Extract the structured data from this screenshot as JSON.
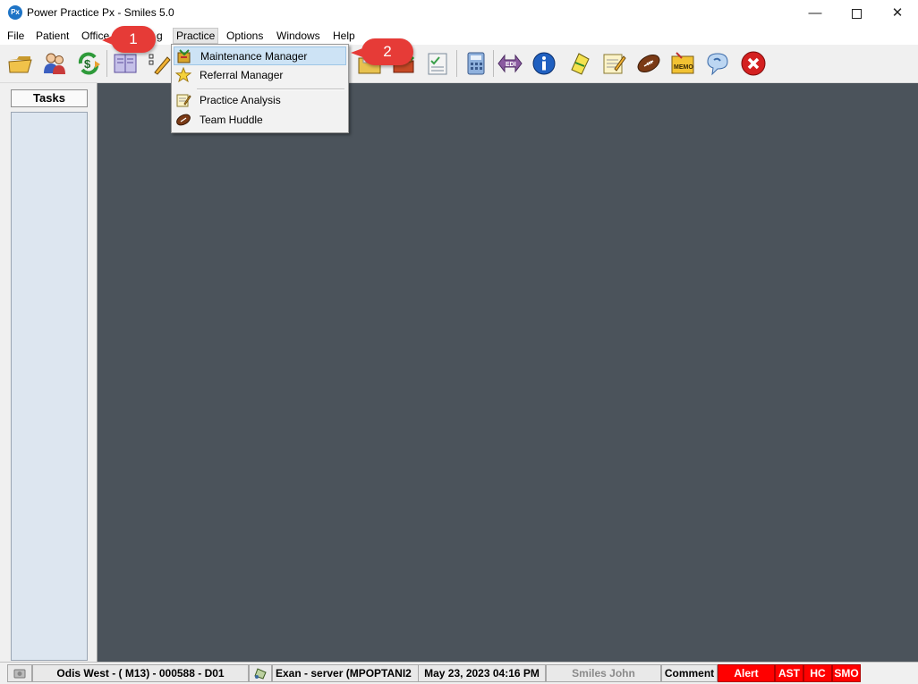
{
  "window": {
    "title": "Power Practice Px - Smiles 5.0",
    "logo_text": "Px"
  },
  "menubar": {
    "file": "File",
    "patient": "Patient",
    "office": "Office",
    "hidden_g": "g",
    "practice": "Practice",
    "options": "Options",
    "windows": "Windows",
    "help": "Help"
  },
  "practice_menu": {
    "items": [
      {
        "label": "Maintenance Manager",
        "icon": "maintenance-icon",
        "highlighted": true
      },
      {
        "label": "Referral Manager",
        "icon": "star-icon"
      },
      {
        "label": "Practice Analysis",
        "icon": "notepad-icon"
      },
      {
        "label": "Team Huddle",
        "icon": "football-icon"
      }
    ]
  },
  "callouts": {
    "step1": "1",
    "step2": "2"
  },
  "toolbar": {
    "icons": [
      "folder-open-icon",
      "patients-icon",
      "money-refresh-icon",
      "ledger-icon",
      "pencil-edit-icon",
      "folder-docs-icon",
      "books-icon",
      "checklist-icon",
      "calculator-icon",
      "edi-icon",
      "info-icon",
      "note-icon",
      "notepad-icon",
      "football-icon",
      "memo-icon",
      "chat-bubble-icon",
      "close-circle-icon"
    ],
    "edi_text": "EDI",
    "memo_text": "MEMO"
  },
  "tasks": {
    "header": "Tasks"
  },
  "status": {
    "location": "Odis West - ( M13) - 000588 - D01",
    "exam": "Exan - server (MPOPTANI2",
    "datetime": "May 23, 2023 04:16 PM",
    "user": "Smiles John",
    "comment": "Comment",
    "alert": "Alert",
    "ast": "AST",
    "hc": "HC",
    "smo": "SMO"
  },
  "colors": {
    "workspace": "#4b535b",
    "callout": "#e63b37",
    "alert_red": "#ff0000",
    "highlight": "#cde3f5"
  }
}
